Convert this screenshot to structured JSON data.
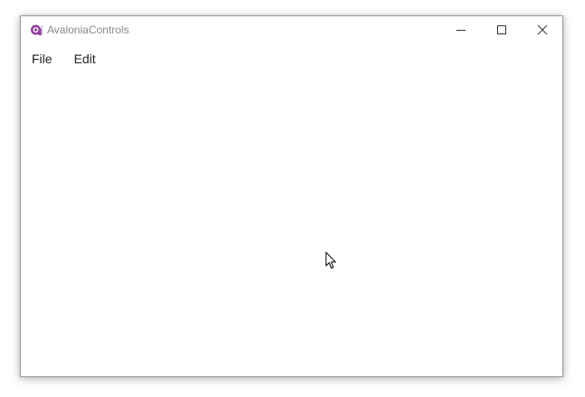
{
  "window": {
    "title": "AvaloniaControls",
    "icon": "avalonia-logo-icon",
    "accent_color": "#8b3f9b",
    "controls": {
      "minimize_icon": "minimize-icon",
      "maximize_icon": "maximize-icon",
      "close_icon": "close-icon"
    }
  },
  "menu": {
    "items": [
      {
        "label": "File"
      },
      {
        "label": "Edit"
      }
    ]
  },
  "content": {
    "cursor_icon": "mouse-pointer-icon"
  }
}
